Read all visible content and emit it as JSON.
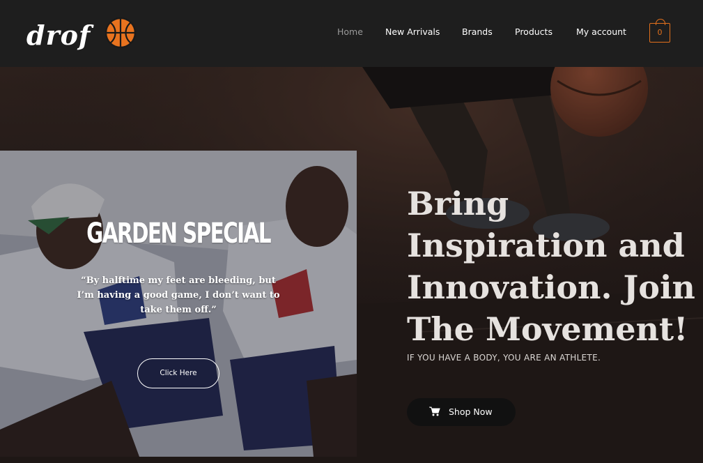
{
  "brand": {
    "logo_text": "drof",
    "logo_icon": "basketball-icon"
  },
  "nav": {
    "items": [
      {
        "label": "Home",
        "active": true
      },
      {
        "label": "New Arrivals"
      },
      {
        "label": "Brands"
      },
      {
        "label": "Products"
      },
      {
        "label": "My account"
      }
    ],
    "cart_count": "0",
    "cart_icon": "shopping-bag-icon"
  },
  "promo": {
    "title": "GARDEN SPECIAL",
    "quote": "“By halftime my feet are bleeding, but I’m having a good game, I don’t want to take them off.”",
    "button_label": "Click Here"
  },
  "hero": {
    "headline": "Bring Inspiration and Innovation. Join The Movement!",
    "tagline": "IF YOU HAVE A BODY, YOU ARE AN ATHLETE.",
    "button_label": "Shop Now",
    "button_icon": "shopping-cart-icon"
  },
  "colors": {
    "header_bg": "#1e1e1e",
    "accent": "#e4711c",
    "button_dark": "#111111",
    "headline_text": "#e6e2df"
  }
}
